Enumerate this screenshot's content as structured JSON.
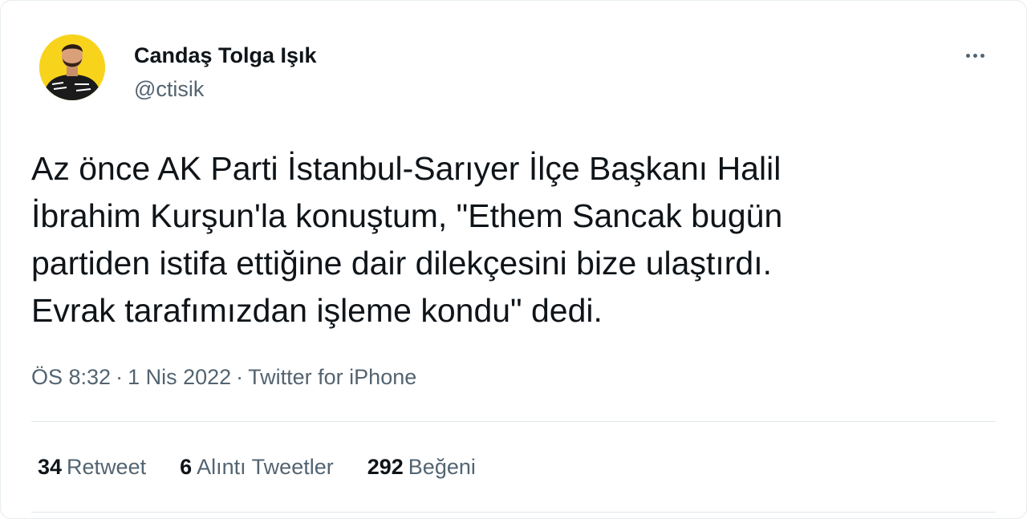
{
  "author": {
    "display_name": "Candaş Tolga Işık",
    "handle": "@ctisik"
  },
  "tweet": {
    "text": "Az önce AK Parti İstanbul-Sarıyer İlçe Başkanı Halil\nİbrahim Kurşun'la konuştum, \"Ethem Sancak bugün\npartiden istifa ettiğine dair dilekçesini bize ulaştırdı.\nEvrak tarafımızdan işleme kondu\" dedi.",
    "time": "ÖS 8:32",
    "date": "1 Nis 2022",
    "source": "Twitter for iPhone",
    "separator": "·"
  },
  "stats": [
    {
      "count": "34",
      "label": "Retweet"
    },
    {
      "count": "6",
      "label": "Alıntı Tweetler"
    },
    {
      "count": "292",
      "label": "Beğeni"
    }
  ],
  "icons": {
    "more": "more-horizontal-icon"
  },
  "colors": {
    "text_primary": "#0f1419",
    "text_secondary": "#536471",
    "divider": "#e1e8ed",
    "avatar_background": "#f7d31c"
  }
}
